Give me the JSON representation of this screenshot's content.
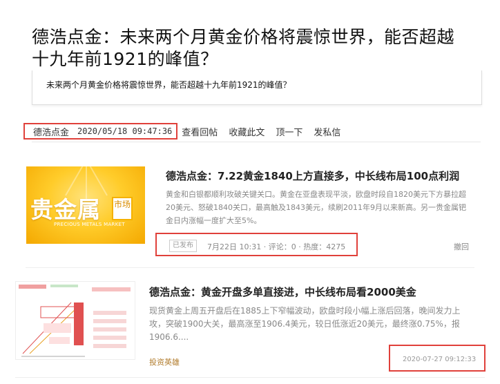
{
  "article": {
    "title": "德浩点金：未来两个月黄金价格将震惊世界，能否超越十九年前1921的峰值？",
    "summary": "未来两个月黄金价格将震惊世界，能否超越十九年前1921的峰值？",
    "author": "德浩点金",
    "timestamp": "2020/05/18 09:47:36",
    "actions": [
      "查看回帖",
      "收藏此文",
      "顶一下",
      "发私信"
    ]
  },
  "cards": [
    {
      "thumb_text": "贵金属",
      "thumb_tag": "市场",
      "thumb_english": "PRECIOUS METALS MARKET",
      "title": "德浩点金：7.22黄金1840上方直接多，中长线布局100点利润",
      "body": "黄金和白银都顺利攻破关键关口。黄金在亚盘表现平淡，欧盘时段自1820美元下方暴拉超20美元、怒破1840关口，最高触及1843美元，续刷2011年9月以来新高。另一贵金属钯金日内涨幅一度扩大至5%。",
      "status": "已发布",
      "date": "7月22日 10:31",
      "comments": "评论：0",
      "heat": "热度：4275",
      "revoke": "撤回"
    },
    {
      "title": "德浩点金：黄金开盘多单直接进，中长线布局看2000美金",
      "body": "现货黄金上周五开盘后在1885上下窄幅波动，欧盘时段小幅上涨后回落，晚间发力上攻，突破1900大关，最高涨至1906.4美元，较日低涨近20美元，最终涨0.75%，报1906.6....",
      "author": "投资英雄",
      "time": "2020-07-27 09:12:33"
    }
  ],
  "colors": {
    "highlight_red": "#e0403a",
    "gold": "#ffcc2a",
    "muted": "#888888"
  }
}
